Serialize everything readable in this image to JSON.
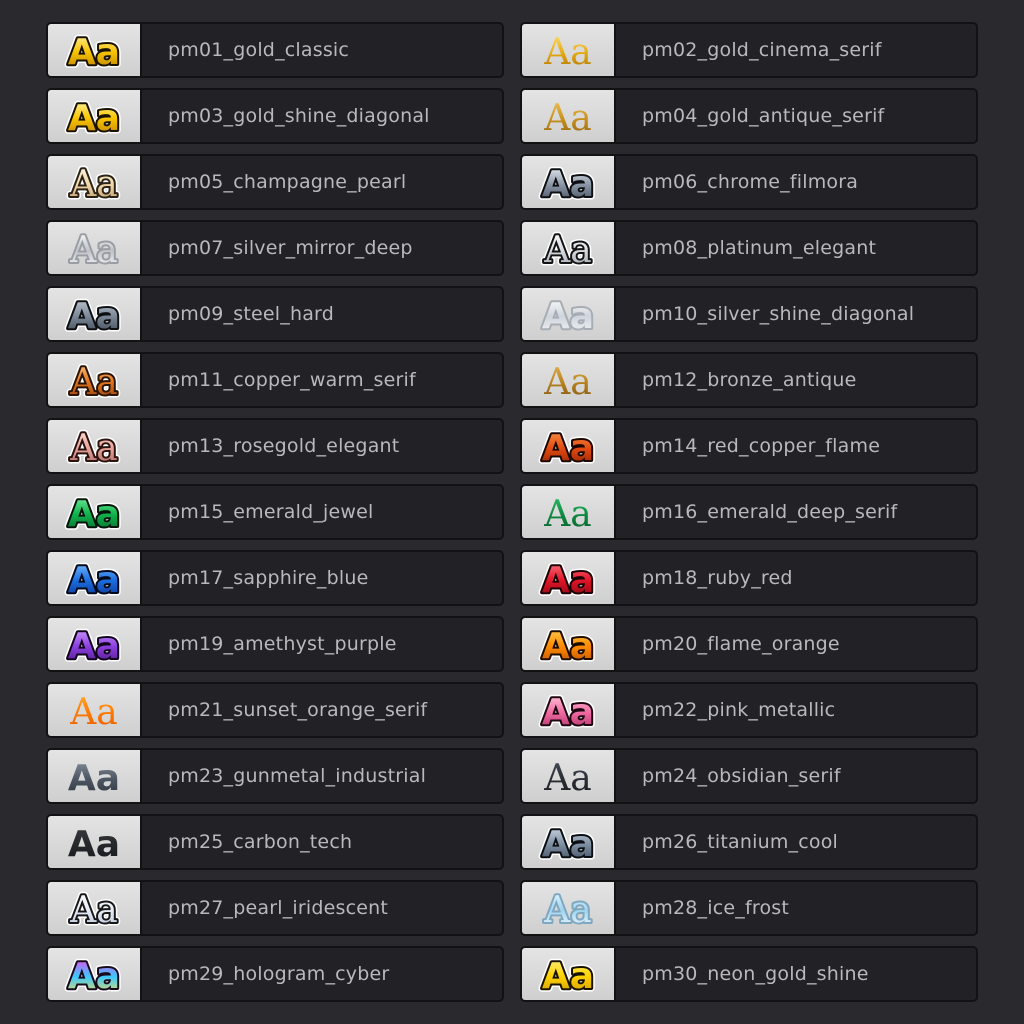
{
  "styles": [
    {
      "name": "pm01_gold_classic",
      "sample": "Aa",
      "font": "sans",
      "stops": [
        "#fff2a0",
        "#f6c200",
        "#b37800"
      ],
      "stroke": "#1a1200",
      "outline": "#ffffff"
    },
    {
      "name": "pm02_gold_cinema_serif",
      "sample": "Aa",
      "font": "serif",
      "stops": [
        "#ffe27a",
        "#e7ab12",
        "#a86f00"
      ],
      "stroke": "none",
      "outline": "none"
    },
    {
      "name": "pm03_gold_shine_diagonal",
      "sample": "Aa",
      "font": "sans",
      "stops": [
        "#fff6b0",
        "#f8c400",
        "#b87a00"
      ],
      "stroke": "#1a1200",
      "outline": "#ffffff"
    },
    {
      "name": "pm04_gold_antique_serif",
      "sample": "Aa",
      "font": "serif",
      "stops": [
        "#f1c85c",
        "#c99220",
        "#8f5f08"
      ],
      "stroke": "none",
      "outline": "none"
    },
    {
      "name": "pm05_champagne_pearl",
      "sample": "Aa",
      "font": "serif",
      "stops": [
        "#fff9e8",
        "#f0d6a8",
        "#b99461"
      ],
      "stroke": "#2b2218",
      "outline": "#ffffff"
    },
    {
      "name": "pm06_chrome_filmora",
      "sample": "Aa",
      "font": "sans",
      "stops": [
        "#f4f7fb",
        "#8b97a6",
        "#3c4656"
      ],
      "stroke": "#0d0f12",
      "outline": "#ffffff"
    },
    {
      "name": "pm07_silver_mirror_deep",
      "sample": "Aa",
      "font": "serif",
      "stops": [
        "#ffffff",
        "#bfc3c8",
        "#ffffff"
      ],
      "stroke": "#9a9ea4",
      "outline": "none"
    },
    {
      "name": "pm08_platinum_elegant",
      "sample": "Aa",
      "font": "serif",
      "stops": [
        "#ffffff",
        "#d7dbe0",
        "#9aa1a9"
      ],
      "stroke": "#141414",
      "outline": "#ffffff"
    },
    {
      "name": "pm09_steel_hard",
      "sample": "Aa",
      "font": "sans",
      "stops": [
        "#c7cfda",
        "#7b8796",
        "#39424e"
      ],
      "stroke": "#0d0f12",
      "outline": "#ffffff"
    },
    {
      "name": "pm10_silver_shine_diagonal",
      "sample": "Aa",
      "font": "sans",
      "stops": [
        "#ffffff",
        "#cfd5dc",
        "#f7f9fb"
      ],
      "stroke": "#a7adb4",
      "outline": "none"
    },
    {
      "name": "pm11_copper_warm_serif",
      "sample": "Aa",
      "font": "serif",
      "stops": [
        "#ffc07a",
        "#e0731f",
        "#8b3c07"
      ],
      "stroke": "#2a1405",
      "outline": "#ffffff"
    },
    {
      "name": "pm12_bronze_antique",
      "sample": "Aa",
      "font": "serif",
      "stops": [
        "#e4b65a",
        "#b8821f",
        "#7a520d"
      ],
      "stroke": "none",
      "outline": "none"
    },
    {
      "name": "pm13_rosegold_elegant",
      "sample": "Aa",
      "font": "serif",
      "stops": [
        "#ffe1d6",
        "#e8a39a",
        "#a8605a"
      ],
      "stroke": "#2a1412",
      "outline": "#ffffff"
    },
    {
      "name": "pm14_red_copper_flame",
      "sample": "Aa",
      "font": "sans",
      "stops": [
        "#ff9a4a",
        "#e04a10",
        "#8c1d02"
      ],
      "stroke": "#1c0800",
      "outline": "#ffffff"
    },
    {
      "name": "pm15_emerald_jewel",
      "sample": "Aa",
      "font": "sans",
      "stops": [
        "#7cf2a2",
        "#10b24c",
        "#04612a"
      ],
      "stroke": "#04140a",
      "outline": "#ffffff"
    },
    {
      "name": "pm16_emerald_deep_serif",
      "sample": "Aa",
      "font": "serif",
      "stops": [
        "#2ec36a",
        "#0f8a40",
        "#06582a"
      ],
      "stroke": "none",
      "outline": "none"
    },
    {
      "name": "pm17_sapphire_blue",
      "sample": "Aa",
      "font": "sans",
      "stops": [
        "#7ec3ff",
        "#1c6de0",
        "#0a2f86"
      ],
      "stroke": "#040a1c",
      "outline": "#ffffff"
    },
    {
      "name": "pm18_ruby_red",
      "sample": "Aa",
      "font": "sans",
      "stops": [
        "#ff7a85",
        "#e01528",
        "#7c0611"
      ],
      "stroke": "#1c0204",
      "outline": "#ffffff"
    },
    {
      "name": "pm19_amethyst_purple",
      "sample": "Aa",
      "font": "sans",
      "stops": [
        "#d4a6ff",
        "#8b3fe0",
        "#4a157f"
      ],
      "stroke": "#12041f",
      "outline": "#ffffff"
    },
    {
      "name": "pm20_flame_orange",
      "sample": "Aa",
      "font": "sans",
      "stops": [
        "#ffd35a",
        "#ff8a00",
        "#b34a00"
      ],
      "stroke": "#1e0c00",
      "outline": "#ffffff"
    },
    {
      "name": "pm21_sunset_orange_serif",
      "sample": "Aa",
      "font": "serif",
      "stops": [
        "#ffb03a",
        "#ff7a00",
        "#e35a00"
      ],
      "stroke": "none",
      "outline": "none"
    },
    {
      "name": "pm22_pink_metallic",
      "sample": "Aa",
      "font": "sans",
      "stops": [
        "#ffd0e2",
        "#f06aa2",
        "#a52a60"
      ],
      "stroke": "#1f0710",
      "outline": "#ffffff"
    },
    {
      "name": "pm23_gunmetal_industrial",
      "sample": "Aa",
      "font": "sans",
      "stops": [
        "#8a939e",
        "#4e5864",
        "#2a323c"
      ],
      "stroke": "none",
      "outline": "none"
    },
    {
      "name": "pm24_obsidian_serif",
      "sample": "Aa",
      "font": "serif",
      "stops": [
        "#4a4f5a",
        "#2b2e36",
        "#17191e"
      ],
      "stroke": "none",
      "outline": "none"
    },
    {
      "name": "pm25_carbon_tech",
      "sample": "Aa",
      "font": "sans",
      "stops": [
        "#3a3d42",
        "#26282c",
        "#15171a"
      ],
      "stroke": "none",
      "outline": "none"
    },
    {
      "name": "pm26_titanium_cool",
      "sample": "Aa",
      "font": "sans",
      "stops": [
        "#d6e0ea",
        "#7d8ea1",
        "#3a4858"
      ],
      "stroke": "#0b0f14",
      "outline": "#ffffff"
    },
    {
      "name": "pm27_pearl_iridescent",
      "sample": "Aa",
      "font": "serif",
      "stops": [
        "#ffffff",
        "#e6ecf6",
        "#b7c3d6"
      ],
      "stroke": "#181818",
      "outline": "#ffffff"
    },
    {
      "name": "pm28_ice_frost",
      "sample": "Aa",
      "font": "serif",
      "stops": [
        "#e9f8ff",
        "#9fd3f0",
        "#ffffff"
      ],
      "stroke": "#7fa8c0",
      "outline": "none"
    },
    {
      "name": "pm29_hologram_cyber",
      "sample": "Aa",
      "font": "sans",
      "stops": [
        "#ff3cf0",
        "#3cc8ff",
        "#ffe14a"
      ],
      "stroke": "#160a1c",
      "outline": "#ffffff"
    },
    {
      "name": "pm30_neon_gold_shine",
      "sample": "Aa",
      "font": "sans",
      "stops": [
        "#fff48a",
        "#ffd200",
        "#c99500"
      ],
      "stroke": "#1a1200",
      "outline": "#ffffff"
    }
  ]
}
